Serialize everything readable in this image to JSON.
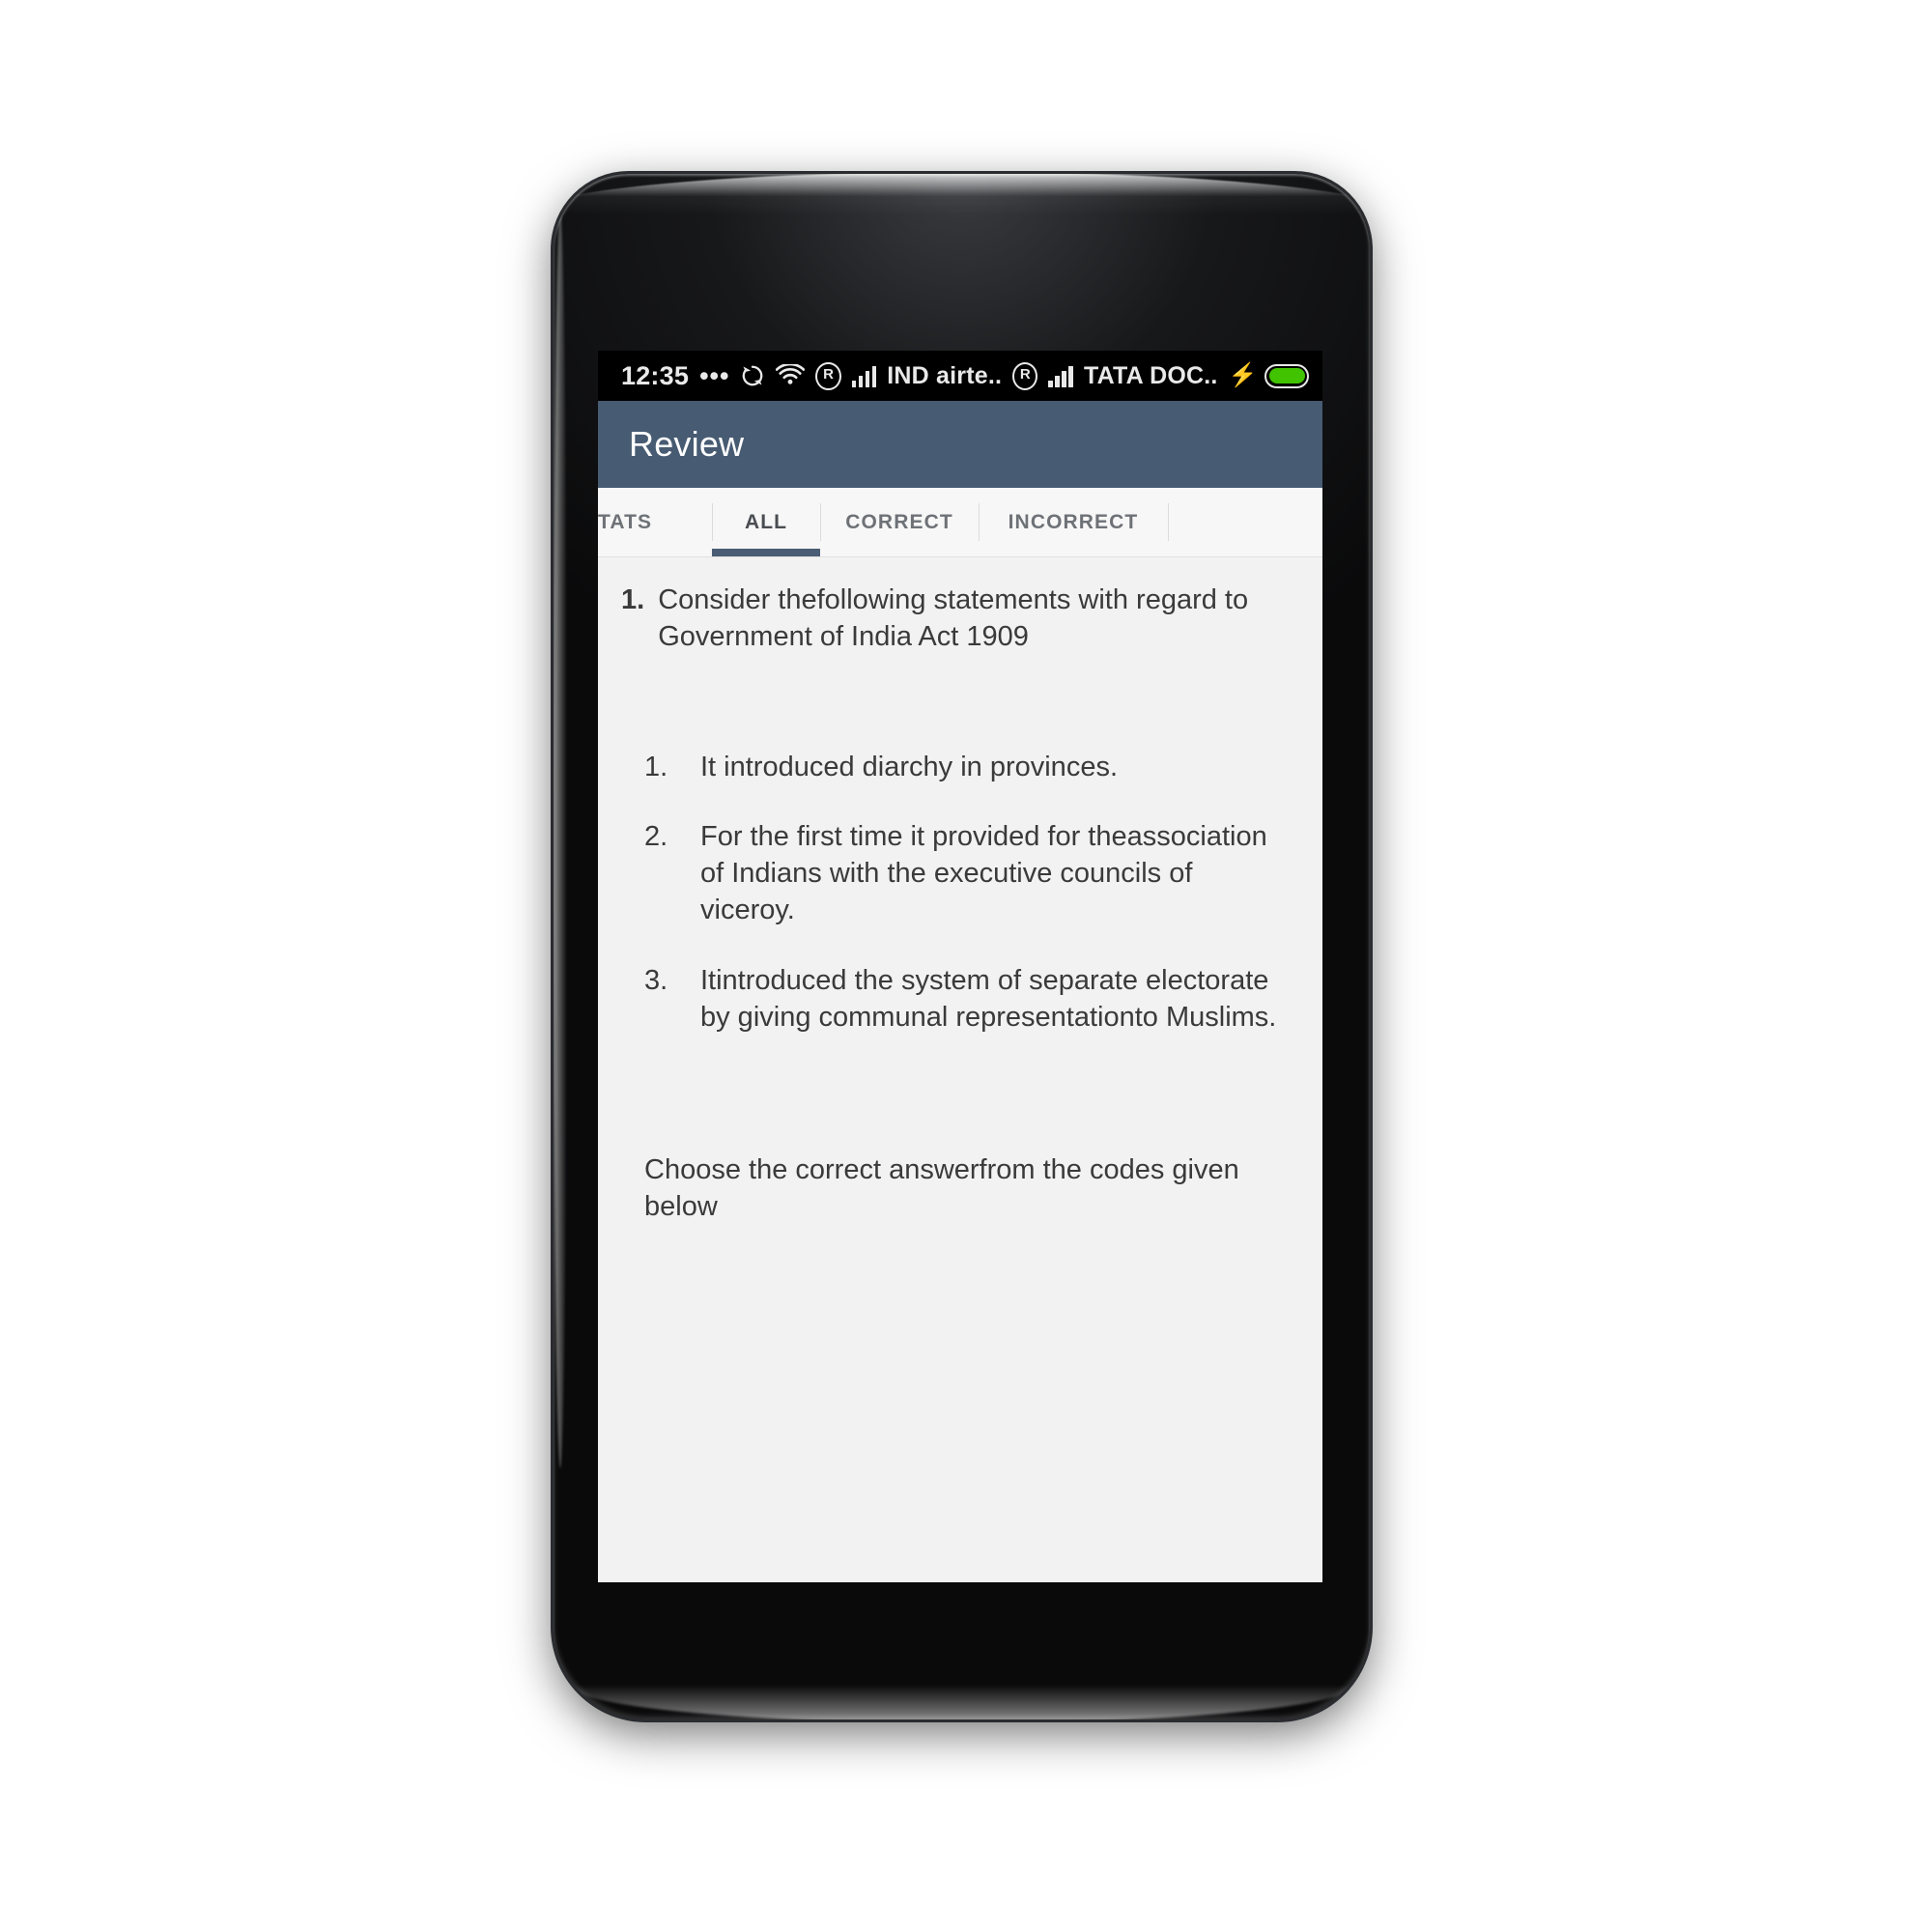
{
  "device": {
    "earpiece_icon": "speaker-grille-icon",
    "front_camera_icon": "front-camera-icon",
    "proximity_sensor_icon": "proximity-sensor-icon"
  },
  "status_bar": {
    "clock": "12:35",
    "overflow_dots": "•••",
    "sync_icon": "sync-rotate-icon",
    "wifi_icon": "wifi-icon",
    "sim1": {
      "roaming_icon": "roaming-r-icon",
      "roaming_label": "R",
      "signal_icon": "signal-bars-icon",
      "carrier": "IND airte.."
    },
    "sim2": {
      "roaming_icon": "roaming-r-icon",
      "roaming_label": "R",
      "signal_icon": "signal-bars-icon",
      "carrier": "TATA DOC.."
    },
    "charging_icon": "charging-bolt-icon",
    "battery_icon": "battery-icon",
    "battery_color": "#41c300"
  },
  "app_bar": {
    "title": "Review",
    "background_color": "#475b72",
    "title_color": "#ffffff"
  },
  "tabs": {
    "accent_color": "#4a5d75",
    "items": [
      {
        "label": "TATS",
        "selected": false,
        "clipped": true
      },
      {
        "label": "ALL",
        "selected": true,
        "clipped": false
      },
      {
        "label": "CORRECT",
        "selected": false,
        "clipped": false
      },
      {
        "label": "INCORRECT",
        "selected": false,
        "clipped": false
      }
    ]
  },
  "question": {
    "number": "1.",
    "stem": "Consider thefollowing statements with regard to Government of India Act 1909",
    "statements": [
      {
        "num": "1.",
        "text": "It introduced diarchy in provinces."
      },
      {
        "num": "2.",
        "text": "For the first time it provided for theassociation of Indians with the executive councils of viceroy."
      },
      {
        "num": "3.",
        "text": "Itintroduced the system of separate electorate by giving communal representationto Muslims."
      }
    ],
    "closing": "Choose the correct answerfrom the codes given below",
    "background_color": "#f2f2f2",
    "text_color": "#3a3a3a"
  }
}
